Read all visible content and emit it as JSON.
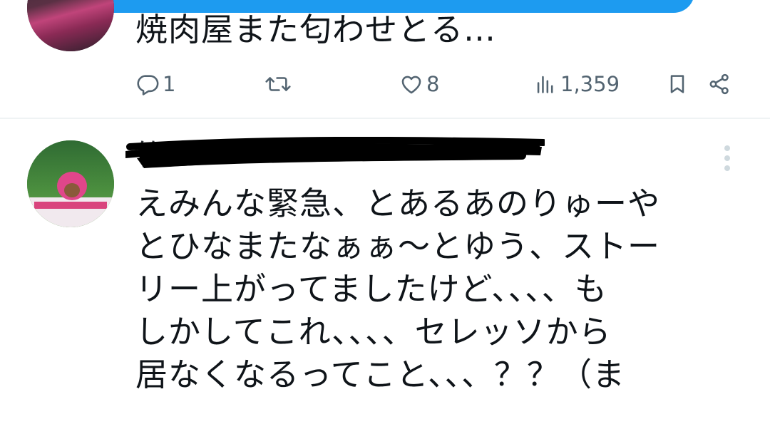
{
  "colors": {
    "accent": "#1d9bf0",
    "muted": "#536471",
    "text": "#0f1419",
    "divider": "#eff3f4"
  },
  "tweet_1": {
    "text": "焼肉屋また匂わせとる…",
    "actions": {
      "reply": {
        "icon": "reply-icon",
        "count": "1"
      },
      "retweet": {
        "icon": "retweet-icon",
        "count": ""
      },
      "like": {
        "icon": "heart-icon",
        "count": "8"
      },
      "views": {
        "icon": "analytics-icon",
        "count": "1,359"
      },
      "bookmark": {
        "icon": "bookmark-icon"
      },
      "share": {
        "icon": "share-icon"
      }
    }
  },
  "tweet_2": {
    "author_name_redacted": "竹",
    "more_icon": "more-vertical-icon",
    "text_lines": [
      "えみんな緊急、とあるあのりゅーや",
      "とひなまたなぁぁ〜とゆう、ストー",
      "リー上がってましたけど、、、、も",
      "しかしてこれ、、、、セレッソから",
      "居なくなるってこと、、、？？（ま"
    ]
  }
}
